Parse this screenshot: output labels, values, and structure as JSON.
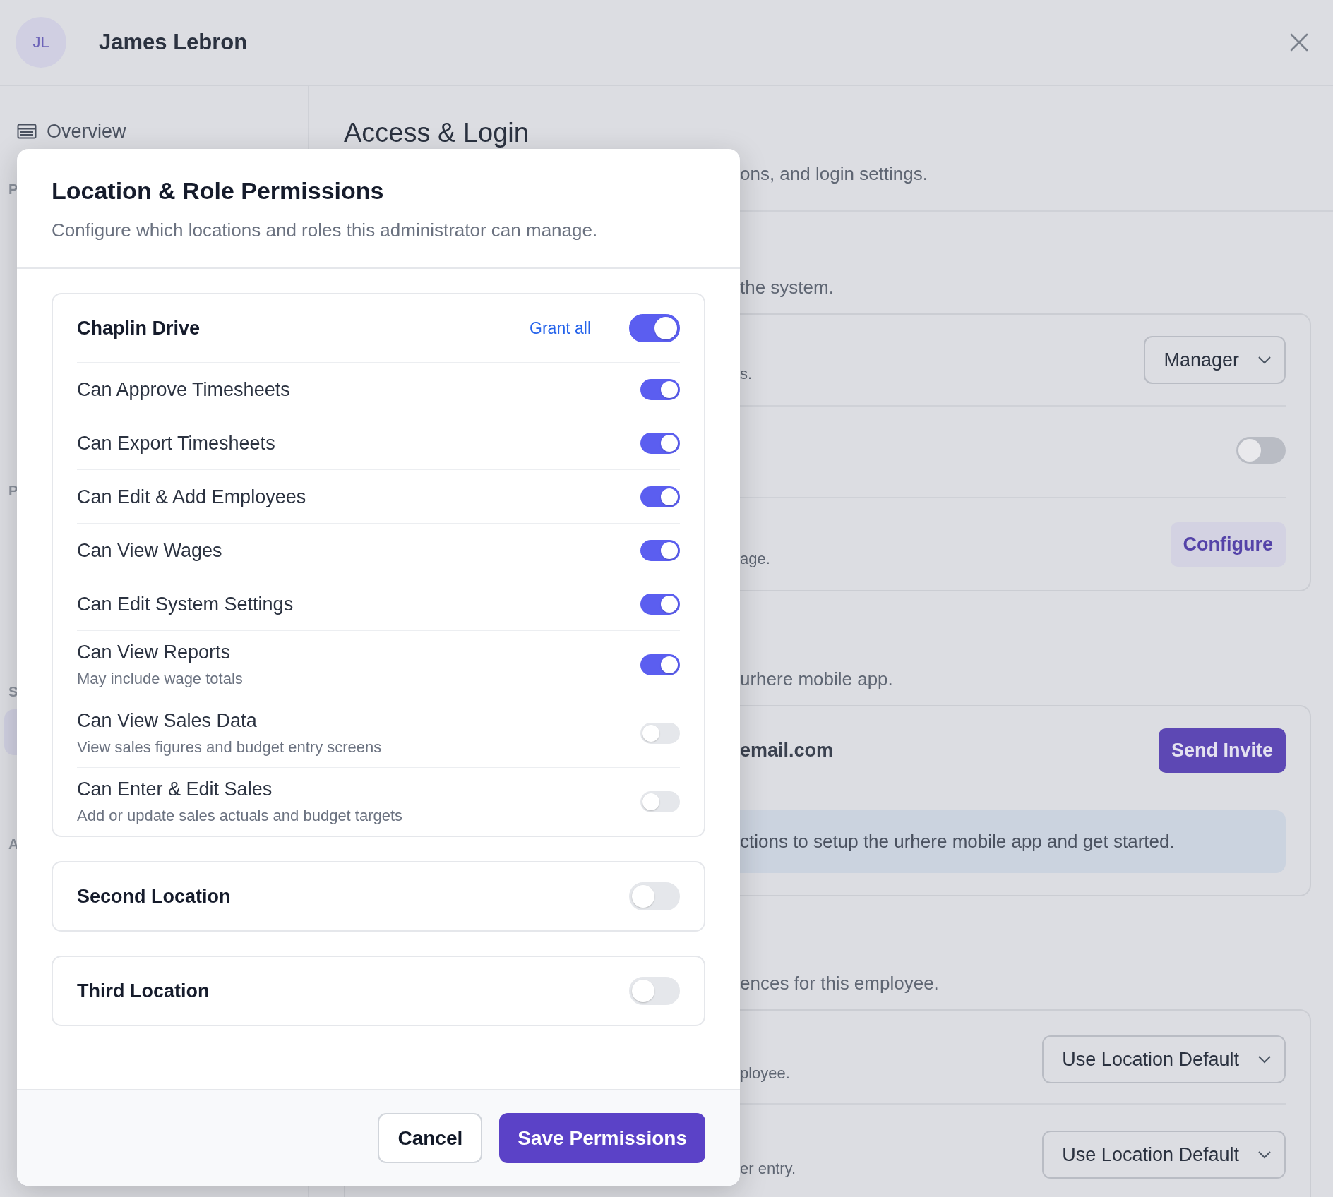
{
  "header": {
    "avatar_initials": "JL",
    "name": "James Lebron"
  },
  "sidebar": {
    "items": [
      {
        "label": "Overview"
      }
    ],
    "headings": [
      "P",
      "P",
      "S",
      "A"
    ]
  },
  "page": {
    "title": "Access & Login",
    "subtitle": "ons, and login settings.",
    "access_section": {
      "description": "the system.",
      "rows": [
        {
          "kind": "select",
          "note": "s.",
          "value": "Manager"
        },
        {
          "kind": "toggle",
          "on": false
        },
        {
          "kind": "button",
          "note": "age.",
          "label": "Configure"
        }
      ]
    },
    "app_section": {
      "description": "urhere mobile app.",
      "email": "email.com",
      "button": "Send Invite",
      "info": "ctions to setup the urhere mobile app and get started."
    },
    "preferences_section": {
      "description": "ences for this employee.",
      "rows": [
        {
          "kind": "select",
          "note": "ployee.",
          "value": "Use Location Default"
        },
        {
          "kind": "select",
          "note": "er entry.",
          "value": "Use Location Default"
        }
      ]
    }
  },
  "modal": {
    "title": "Location & Role Permissions",
    "subtitle": "Configure which locations and roles this administrator can manage.",
    "locations": [
      {
        "name": "Chaplin Drive",
        "grant_all": "Grant all",
        "on": true,
        "permissions": [
          {
            "label": "Can Approve Timesheets",
            "on": true
          },
          {
            "label": "Can Export Timesheets",
            "on": true
          },
          {
            "label": "Can Edit & Add Employees",
            "on": true
          },
          {
            "label": "Can View Wages",
            "on": true
          },
          {
            "label": "Can Edit System Settings",
            "on": true
          },
          {
            "label": "Can View Reports",
            "hint": "May include wage totals",
            "on": true
          },
          {
            "label": "Can View Sales Data",
            "hint": "View sales figures and budget entry screens",
            "on": false
          },
          {
            "label": "Can Enter & Edit Sales",
            "hint": "Add or update sales actuals and budget targets",
            "on": false
          }
        ]
      },
      {
        "name": "Second Location",
        "on": false
      },
      {
        "name": "Third Location",
        "on": false
      }
    ],
    "cancel": "Cancel",
    "save": "Save Permissions"
  }
}
